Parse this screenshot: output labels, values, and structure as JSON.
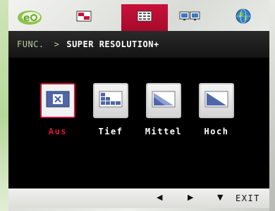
{
  "colors": {
    "accent": "#c8113a",
    "panel_bg": "#000000",
    "breadcrumb_root": "#b9c9a0"
  },
  "tabs": [
    {
      "icon": "eco-leaf-icon",
      "active": false
    },
    {
      "icon": "picture-icon",
      "active": false
    },
    {
      "icon": "grid-menu-icon",
      "active": true
    },
    {
      "icon": "dual-display-icon",
      "active": false
    },
    {
      "icon": "globe-icon",
      "active": false
    }
  ],
  "header": {
    "root": "FUNC.",
    "separator": ">",
    "current": "SUPER RESOLUTION+"
  },
  "options": [
    {
      "label": "Aus",
      "icon": "off-x-icon",
      "selected": true
    },
    {
      "label": "Tief",
      "icon": "low-resolution-icon",
      "selected": false
    },
    {
      "label": "Mittel",
      "icon": "medium-resolution-icon",
      "selected": false
    },
    {
      "label": "Hoch",
      "icon": "high-resolution-icon",
      "selected": false
    }
  ],
  "footer": {
    "left": "◀",
    "right": "▶",
    "down": "▼",
    "exit": "EXIT"
  }
}
